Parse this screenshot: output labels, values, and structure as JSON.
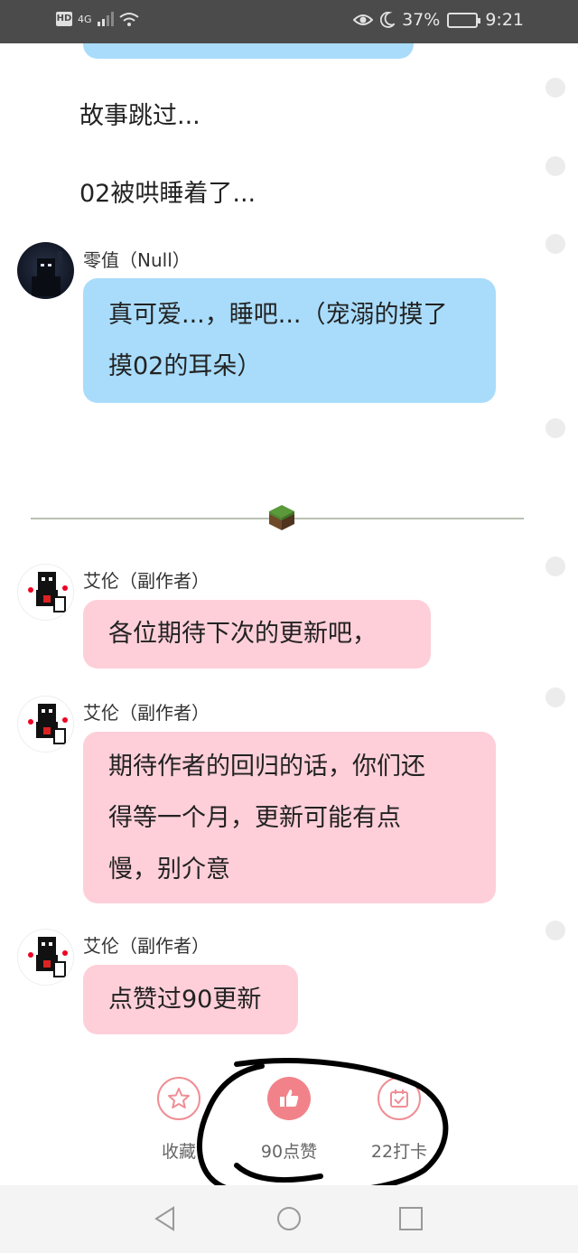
{
  "status_bar": {
    "network_badge": "HD",
    "network_type": "4G",
    "battery_percent": "37%",
    "time": "9:21",
    "icons": [
      "hd-icon",
      "signal-icon",
      "wifi-icon",
      "eye-icon",
      "moon-icon",
      "battery-icon"
    ]
  },
  "story": {
    "narration": [
      "故事跳过...",
      "02被哄睡着了..."
    ],
    "messages": [
      {
        "author": "零值（Null）",
        "text_lines": [
          "真可爱...，睡吧...（宠溺的摸了",
          "摸02的耳朵）"
        ],
        "color": "#a9dcfb"
      },
      {
        "author": "艾伦（副作者）",
        "text_lines": [
          "各位期待下次的更新吧，"
        ],
        "color": "#fecfd9"
      },
      {
        "author": "艾伦（副作者）",
        "text_lines": [
          "期待作者的回归的话，你们还",
          "得等一个月，更新可能有点",
          "慢，别介意"
        ],
        "color": "#fecfd9"
      },
      {
        "author": "艾伦（副作者）",
        "text_lines": [
          "点赞过90更新"
        ],
        "color": "#fecfd9"
      }
    ]
  },
  "actions": {
    "collect_label": "收藏",
    "like_label": "90点赞",
    "checkin_label": "22打卡",
    "accent_color": "#f2828a"
  },
  "nav_bar": {
    "icons": [
      "back-icon",
      "home-icon",
      "recents-icon"
    ]
  }
}
